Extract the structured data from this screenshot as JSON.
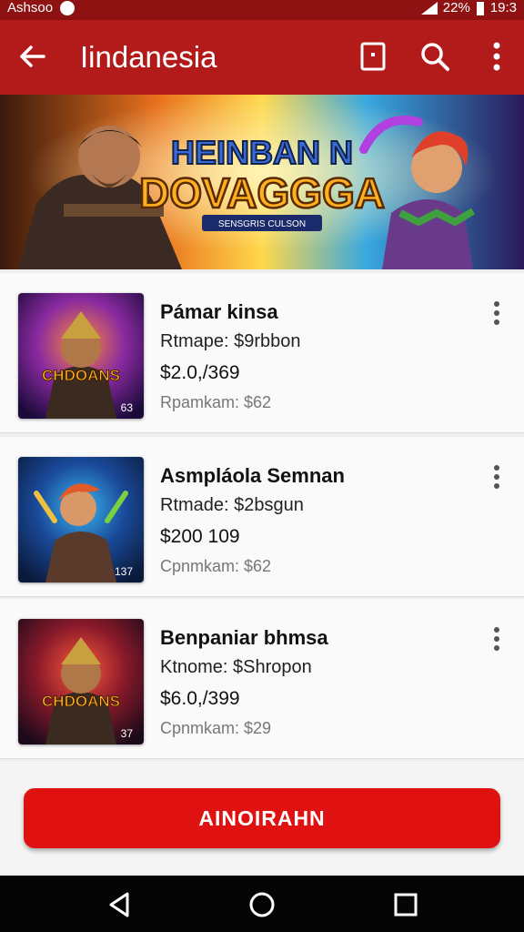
{
  "status_bar": {
    "carrier": "Ashsoo",
    "battery_text": "22%",
    "time": "19:3"
  },
  "app_bar": {
    "title": "Iindanesia"
  },
  "banner": {
    "title_line1": "HEINBAN N",
    "title_line2": "DOVAGGGA",
    "ribbon": "SENSGRIS CULSON"
  },
  "items": [
    {
      "name": "Pámar kinsa",
      "subtitle": "Rtmape: $9rbbon",
      "price": "$2.0,/369",
      "meta": "Rpamkam: $62",
      "thumb_title": "CHDOANS",
      "thumb_badge": "63"
    },
    {
      "name": "Asmpláola Semnan",
      "subtitle": "Rtmade: $2bsgun",
      "price": "$200 109",
      "meta": "Cpnmkam: $62",
      "thumb_title": "",
      "thumb_badge": "137"
    },
    {
      "name": "Benpaniar bhmsa",
      "subtitle": "Ktnome: $Shropon",
      "price": "$6.0,/399",
      "meta": "Cpnmkam: $29",
      "thumb_title": "CHDOANS",
      "thumb_badge": "37"
    }
  ],
  "action_button": {
    "label": "AINOIRAHN"
  },
  "colors": {
    "primary": "#b31a1a",
    "status_bar": "#8f1212",
    "button": "#e01111"
  }
}
